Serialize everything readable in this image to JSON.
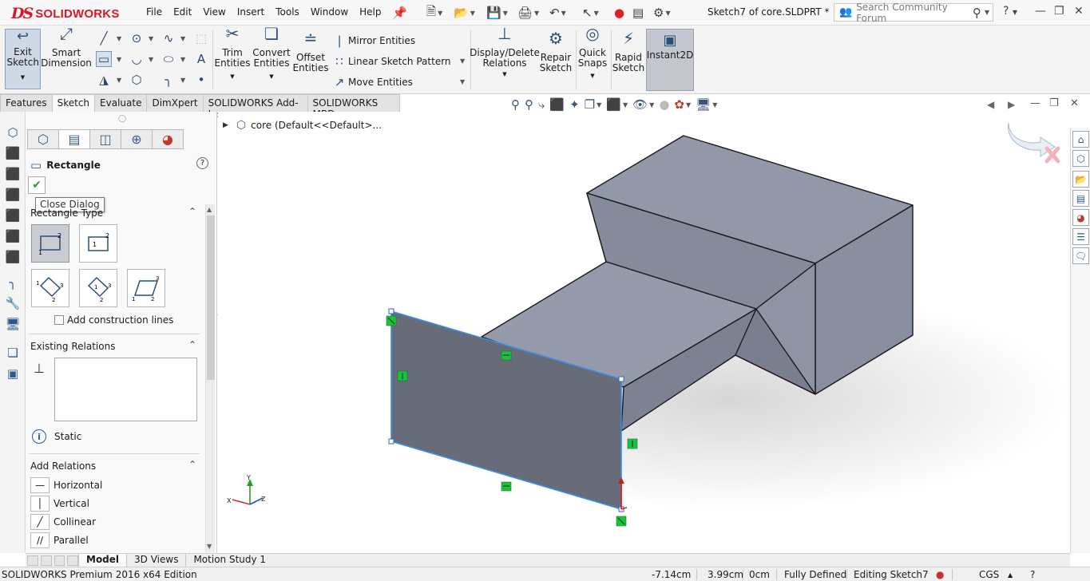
{
  "app": {
    "brand": "SOLIDWORKS",
    "menus": [
      "File",
      "Edit",
      "View",
      "Insert",
      "Tools",
      "Window",
      "Help"
    ],
    "doc_title": "Sketch7 of core.SLDPRT *",
    "search_placeholder": "Search Community Forum",
    "help_glyph": "?"
  },
  "ribbon": {
    "exit_sketch": "Exit Sketch",
    "smart_dimension": "Smart Dimension",
    "trim_entities": "Trim Entities",
    "convert_entities": "Convert Entities",
    "offset_entities": "Offset Entities",
    "mirror_entities": "Mirror Entities",
    "linear_sketch_pattern": "Linear Sketch Pattern",
    "move_entities": "Move Entities",
    "display_delete_relations": "Display/Delete Relations",
    "repair_sketch": "Repair Sketch",
    "quick_snaps": "Quick Snaps",
    "rapid_sketch": "Rapid Sketch",
    "instant2d": "Instant2D"
  },
  "tabs": [
    {
      "label": "Features",
      "active": false
    },
    {
      "label": "Sketch",
      "active": true
    },
    {
      "label": "Evaluate",
      "active": false
    },
    {
      "label": "DimXpert",
      "active": false
    },
    {
      "label": "SOLIDWORKS Add-Ins",
      "active": false
    },
    {
      "label": "SOLIDWORKS MBD",
      "active": false
    }
  ],
  "property_manager": {
    "title": "Rectangle",
    "tooltip": "Close Dialog",
    "rect_type_label": "Rectangle Type",
    "add_construction_lines": "Add construction lines",
    "existing_relations_label": "Existing Relations",
    "status": "Static",
    "add_relations_label": "Add Relations",
    "relations": [
      "Horizontal",
      "Vertical",
      "Collinear",
      "Parallel"
    ]
  },
  "tree": {
    "root": "core  (Default<<Default>..."
  },
  "bottom_tabs": [
    "Model",
    "3D Views",
    "Motion Study 1"
  ],
  "status_bar": {
    "edition": "SOLIDWORKS Premium 2016 x64 Edition",
    "x": "-7.14cm",
    "y": "3.99cm",
    "z": "0cm",
    "state": "Fully Defined",
    "editing": "Editing Sketch7",
    "units": "CGS"
  },
  "colors": {
    "brand_red": "#d4192c",
    "model_face": "#8f95a3",
    "sketch_fill": "#686b78",
    "sketch_edge": "#3d8ee8",
    "relation_marker": "#1ec040"
  }
}
